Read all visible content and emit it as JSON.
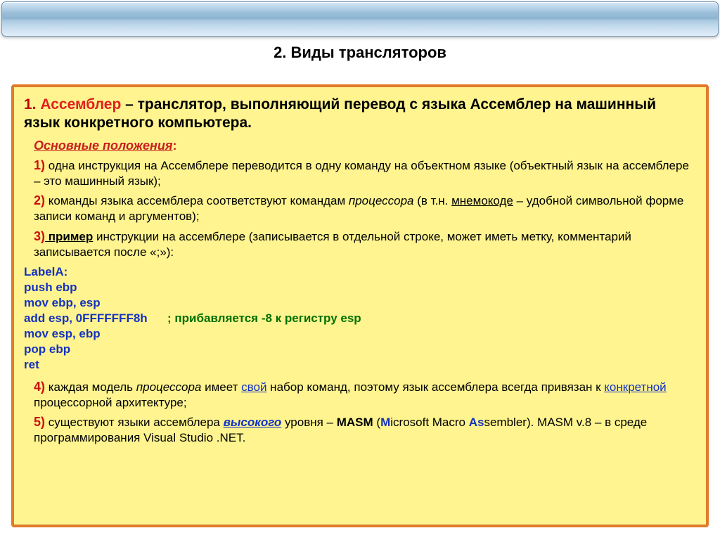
{
  "header": {
    "section_title": "2. Виды трансляторов"
  },
  "main": {
    "lead_num": "1. ",
    "lead_term": "Ассемблер",
    "lead_rest": " – транслятор, выполняющий перевод с языка Ассемблер на машинный язык конкретного компьютера.",
    "subheading": "Основные положения",
    "items": {
      "i1_num": "1)",
      "i1_text": " одна инструкция на Ассемблере переводится в одну команду на объектном языке (объектный язык на ассемблере – это машинный язык);",
      "i2_num": "2)",
      "i2_pre": " команды языка ассемблера соответствуют  командам ",
      "i2_em": "процессора",
      "i2_mid": " (в т.н. ",
      "i2_under": "мнемокоде",
      "i2_post": " – удобной символьной форме записи команд и аргументов);",
      "i3_num": "3)",
      "i3_bold_under": " пример",
      "i3_rest": " инструкции на ассемблере (записывается в отдельной строке, может иметь метку, комментарий  записывается после «;»):",
      "i4_num": "4)",
      "i4_pre": " каждая модель ",
      "i4_em": "процессора",
      "i4_mid1": " имеет ",
      "i4_link1": "свой",
      "i4_mid2": " набор команд, поэтому язык ассемблера всегда привязан к ",
      "i4_link2": "конкретной",
      "i4_post": " процессорной архитектуре;",
      "i5_num": "5)",
      "i5_pre": " существуют  языки ассемблера ",
      "i5_emu": "высокого",
      "i5_mid1": " уровня – ",
      "i5_masm": "MASM",
      "i5_open": " (",
      "i5_M": "M",
      "i5_icrosoft": "icrosoft Macro ",
      "i5_As": "As",
      "i5_sem": "sem",
      "i5_bler": "bler). MASM v.8 – в среде программирования Visual Studio .NET."
    },
    "code": {
      "l1": "LabelA:",
      "l2": "push ebp",
      "l3": "mov ebp, esp",
      "l4a": "add esp, 0FFFFFFF8h",
      "l4b": "      ; прибавляется -8 к регистру esp",
      "l5": "mov esp, ebp",
      "l6": "pop ebp",
      "l7": "ret"
    }
  }
}
